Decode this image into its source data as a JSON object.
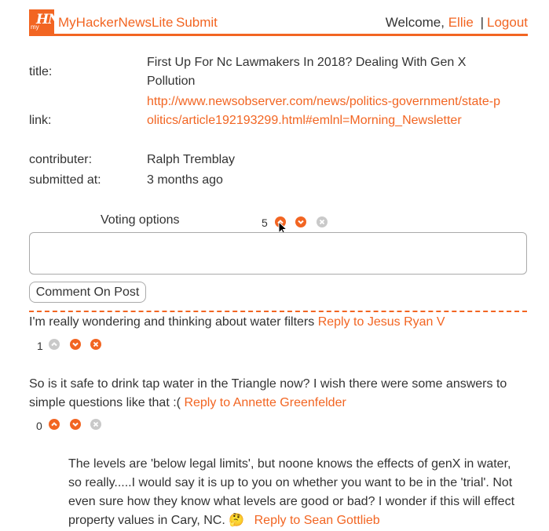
{
  "header": {
    "brand": "MyHackerNewsLite",
    "submit_label": "Submit",
    "welcome_text": "Welcome,",
    "username": "Ellie",
    "separator": "|",
    "logout_label": "Logout",
    "logo_text": "HN",
    "logo_prefix": "my"
  },
  "post": {
    "title_label": "title:",
    "title_value": "First Up For Nc Lawmakers In 2018? Dealing With Gen X Pollution",
    "link_label": "link:",
    "link_value": "http://www.newsobserver.com/news/politics-government/state-politics/article192193299.html#emlnl=Morning_Newsletter",
    "contributor_label": "contributer:",
    "contributor_value": "Ralph Tremblay",
    "submitted_label": "submitted at:",
    "submitted_value": "3 months ago"
  },
  "voting": {
    "label": "Voting options",
    "count": "5"
  },
  "comment_form": {
    "textarea_value": "",
    "button_label": "Comment On Post"
  },
  "comments": [
    {
      "text": "I'm really wondering and thinking about water filters",
      "reply_label": "Reply to Jesus Ryan V",
      "votes": "1"
    },
    {
      "text": "So is it safe to drink tap water in the Triangle now? I wish there were some answers to simple questions like that :(",
      "reply_label": "Reply to Annette Greenfelder",
      "votes": "0"
    },
    {
      "text": "The levels are 'below legal limits', but noone knows the effects of genX in water, so really.....I would say it is up to you on whether you want to be in the 'trial'. Not even sure how they know what levels are good or bad? I wonder if this will effect property values in Cary, NC.",
      "emoji": "🤔",
      "reply_label": "Reply to Sean Gottlieb"
    }
  ],
  "colors": {
    "accent": "#f26522",
    "disabled": "#c9c9c9"
  },
  "icons": {
    "upvote": "chevron-up-circle-icon",
    "downvote": "chevron-down-circle-icon",
    "remove": "x-circle-icon"
  }
}
